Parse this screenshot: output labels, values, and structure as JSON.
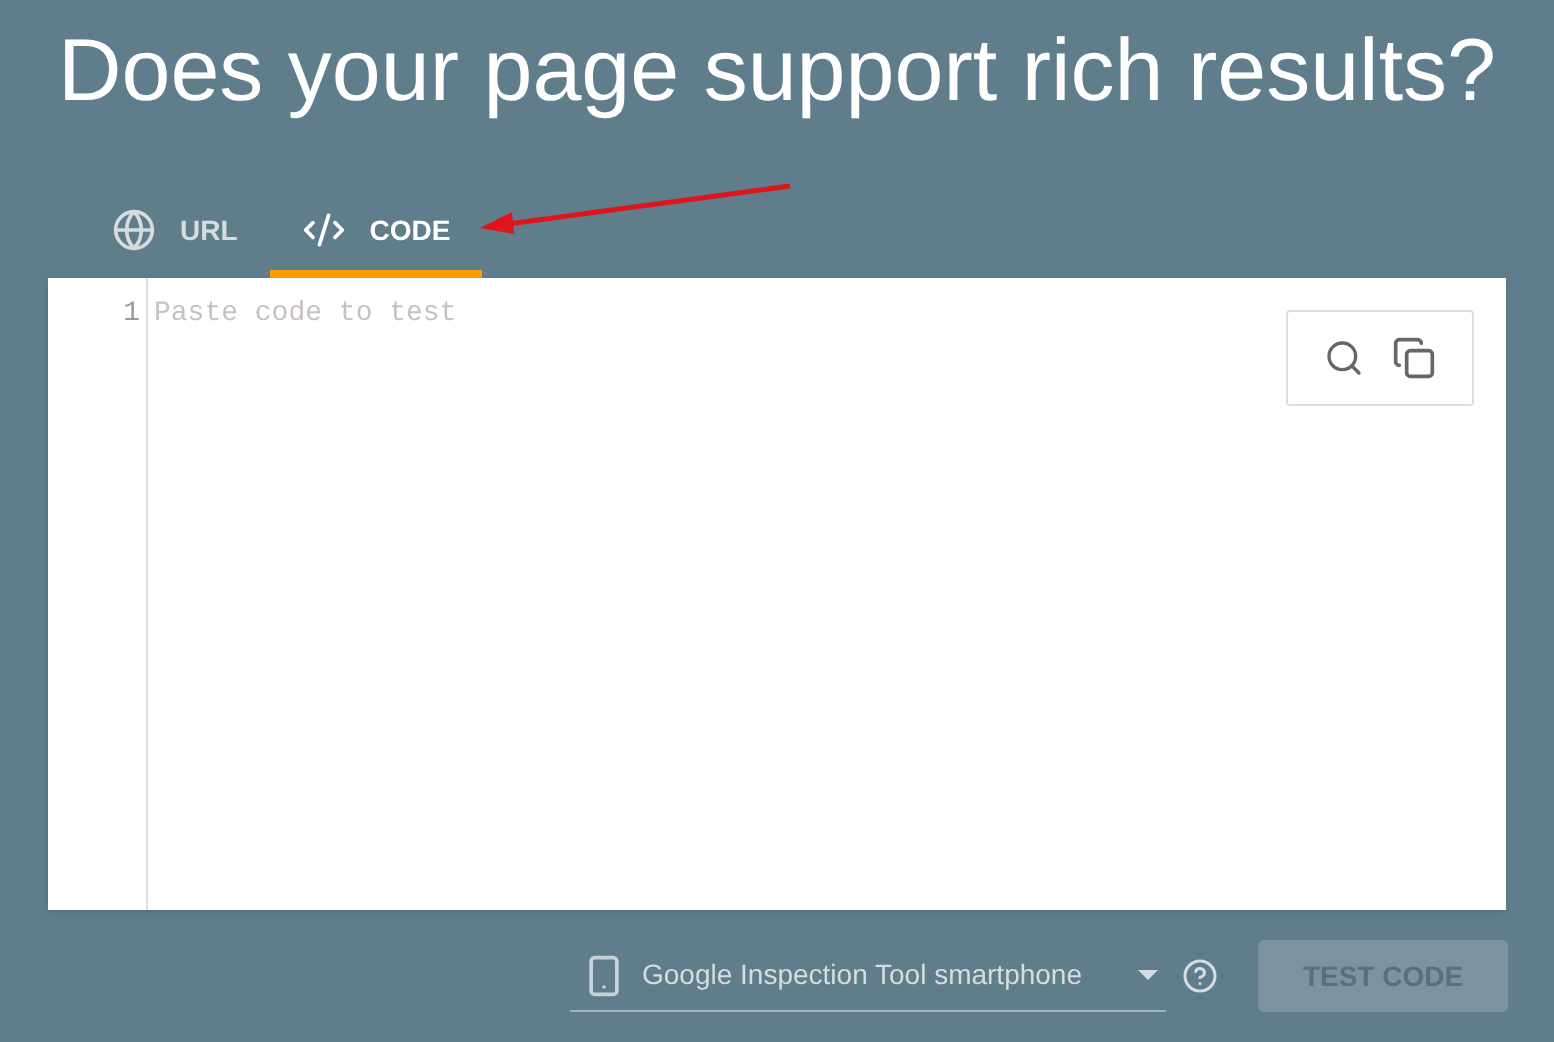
{
  "heading": "Does your page support rich results?",
  "tabs": [
    {
      "kind": "url",
      "label": "URL",
      "selected": false
    },
    {
      "kind": "code",
      "label": "CODE",
      "selected": true
    }
  ],
  "editor": {
    "line_number": "1",
    "placeholder": "Paste code to test"
  },
  "device_select": {
    "value": "Google Inspection Tool smartphone"
  },
  "test_button": {
    "label": "TEST CODE",
    "disabled": true
  }
}
